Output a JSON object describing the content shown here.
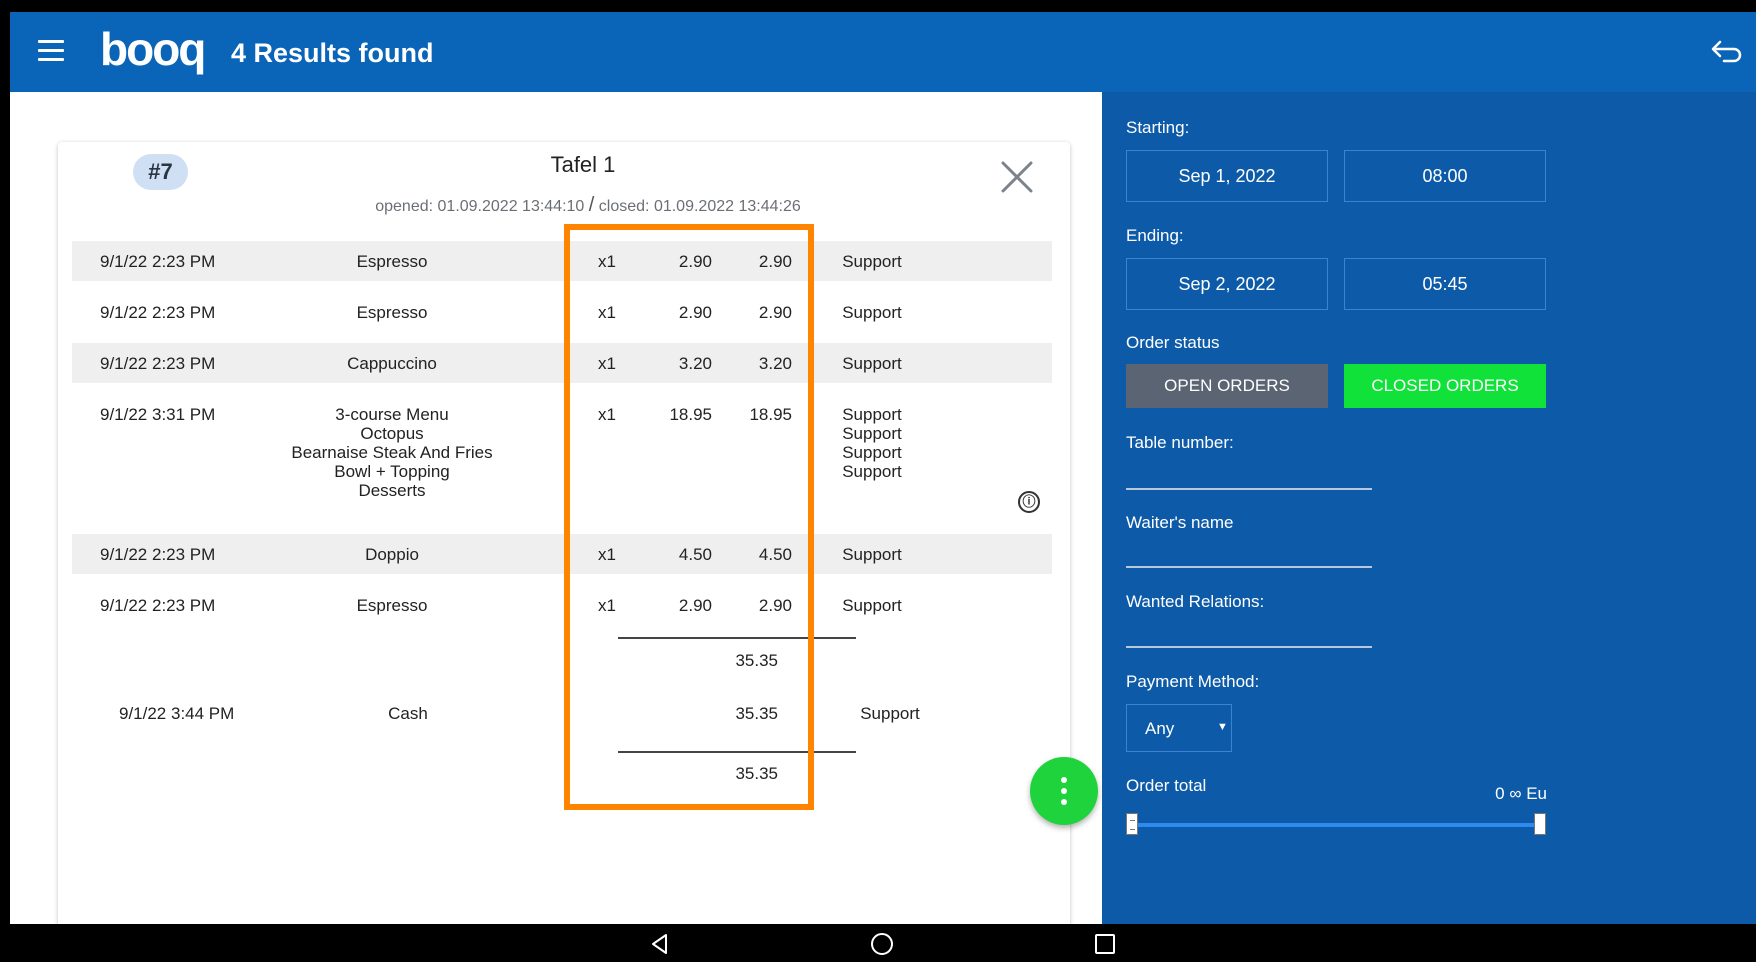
{
  "header": {
    "logo": "booq",
    "title": "4 Results found"
  },
  "order": {
    "badge": "#7",
    "table": "Tafel 1",
    "opened_label": "opened: 01.09.2022 13:44:10",
    "separator": "/",
    "closed_label": "closed: 01.09.2022 13:44:26",
    "lines": [
      {
        "time": "9/1/22 2:23 PM",
        "item": "Espresso",
        "qty": "x1",
        "price": "2.90",
        "total": "2.90",
        "waiter": "Support"
      },
      {
        "time": "9/1/22 2:23 PM",
        "item": "Espresso",
        "qty": "x1",
        "price": "2.90",
        "total": "2.90",
        "waiter": "Support"
      },
      {
        "time": "9/1/22 2:23 PM",
        "item": "Cappuccino",
        "qty": "x1",
        "price": "3.20",
        "total": "3.20",
        "waiter": "Support"
      },
      {
        "time": "9/1/22 3:31 PM",
        "item_lines": [
          "3-course Menu",
          "Octopus",
          "Bearnaise Steak And Fries",
          "Bowl + Topping",
          "Desserts"
        ],
        "qty": "x1",
        "price": "18.95",
        "total": "18.95",
        "waiter_lines": [
          "Support",
          "Support",
          "Support",
          "Support"
        ]
      },
      {
        "time": "9/1/22 2:23 PM",
        "item": "Doppio",
        "qty": "x1",
        "price": "4.50",
        "total": "4.50",
        "waiter": "Support"
      },
      {
        "time": "9/1/22 2:23 PM",
        "item": "Espresso",
        "qty": "x1",
        "price": "2.90",
        "total": "2.90",
        "waiter": "Support"
      }
    ],
    "subtotal": "35.35",
    "payment": {
      "time": "9/1/22 3:44 PM",
      "method": "Cash",
      "amount": "35.35",
      "waiter": "Support"
    },
    "grand_total": "35.35",
    "info_icon": "ⓘ"
  },
  "filters": {
    "starting_label": "Starting:",
    "start_date": "Sep 1, 2022",
    "start_time": "08:00",
    "ending_label": "Ending:",
    "end_date": "Sep 2, 2022",
    "end_time": "05:45",
    "order_status_label": "Order status",
    "open_orders": "OPEN ORDERS",
    "closed_orders": "CLOSED ORDERS",
    "table_number_label": "Table number:",
    "waiter_label": "Waiter's name",
    "relations_label": "Wanted Relations:",
    "payment_method_label": "Payment Method:",
    "payment_method_value": "Any",
    "order_total_label": "Order total",
    "order_total_range": "0 ∞ Eu"
  },
  "colors": {
    "appbar": "#0a65b8",
    "panel": "#0d5ba8",
    "highlight": "#ff8400",
    "closed_active": "#10e239",
    "fab": "#1fd33c"
  }
}
